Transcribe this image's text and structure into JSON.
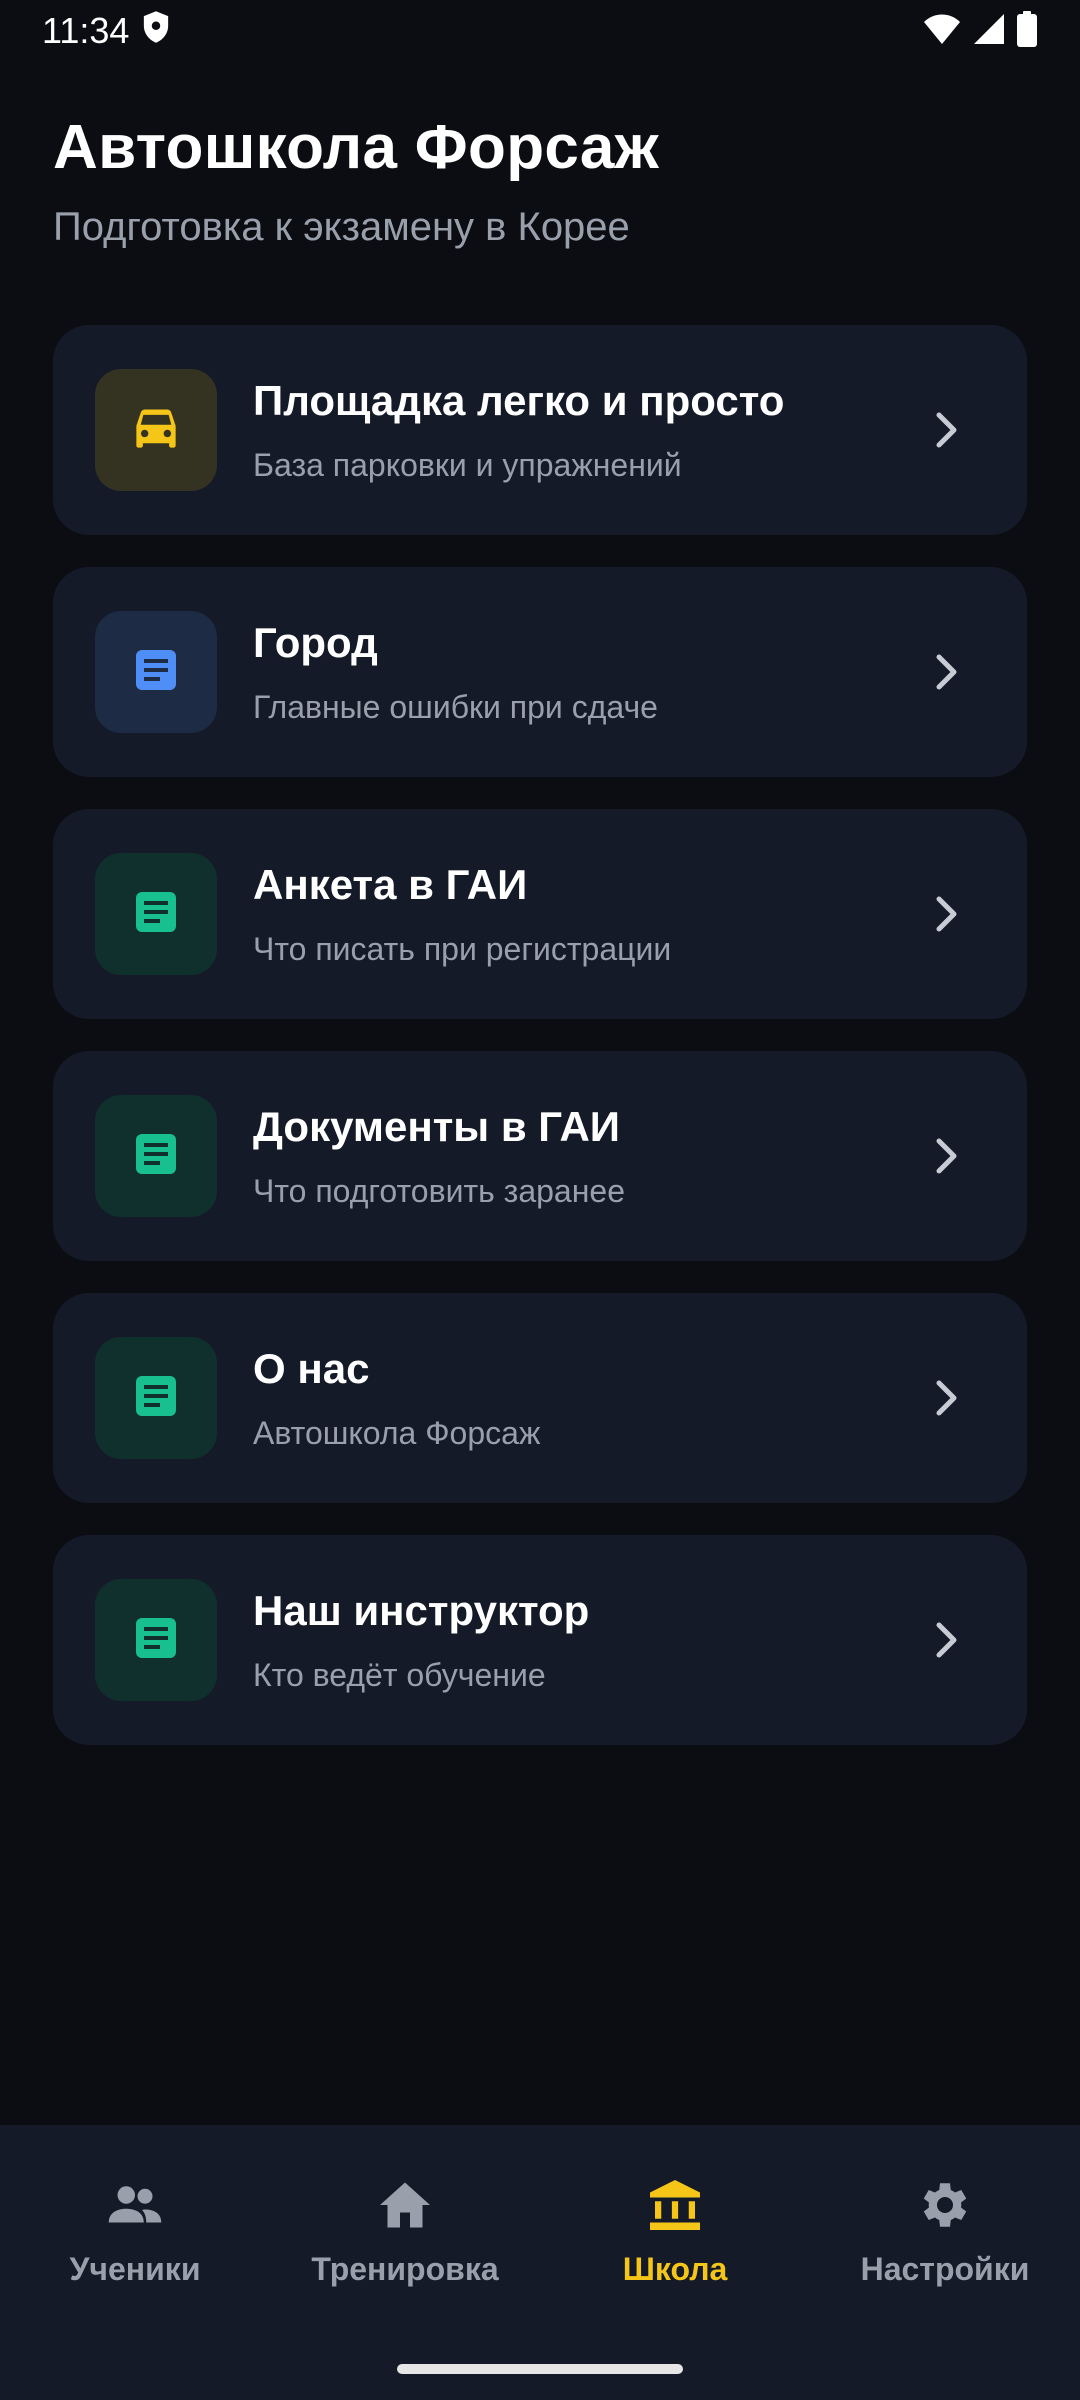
{
  "status_bar": {
    "time": "11:34",
    "icons": [
      "shield-icon",
      "wifi-icon",
      "signal-icon",
      "battery-icon"
    ]
  },
  "header": {
    "title": "Автошкола Форсаж",
    "subtitle": "Подготовка к экзамену в Корее"
  },
  "cards": [
    {
      "title": "Площадка легко и просто",
      "subtitle": "База парковки и упражнений",
      "icon": "car-icon",
      "accent": "#f5c518"
    },
    {
      "title": "Город",
      "subtitle": "Главные ошибки при сдаче",
      "icon": "document-icon",
      "accent": "#4f8ef7"
    },
    {
      "title": "Анкета в ГАИ",
      "subtitle": "Что писать при регистрации",
      "icon": "document-icon",
      "accent": "#18c08f"
    },
    {
      "title": "Документы в ГАИ",
      "subtitle": "Что подготовить заранее",
      "icon": "document-icon",
      "accent": "#18c08f"
    },
    {
      "title": "О нас",
      "subtitle": "Автошкола Форсаж",
      "icon": "document-icon",
      "accent": "#18c08f"
    },
    {
      "title": "Наш инструктор",
      "subtitle": "Кто ведёт обучение",
      "icon": "document-icon",
      "accent": "#18c08f"
    }
  ],
  "bottom_nav": {
    "items": [
      {
        "label": "Ученики",
        "icon": "people-icon",
        "active": false
      },
      {
        "label": "Тренировка",
        "icon": "home-icon",
        "active": false
      },
      {
        "label": "Школа",
        "icon": "school-icon",
        "active": true
      },
      {
        "label": "Настройки",
        "icon": "gear-icon",
        "active": false
      }
    ],
    "active_color": "#f5c518",
    "inactive_color": "#9aa0ab"
  }
}
